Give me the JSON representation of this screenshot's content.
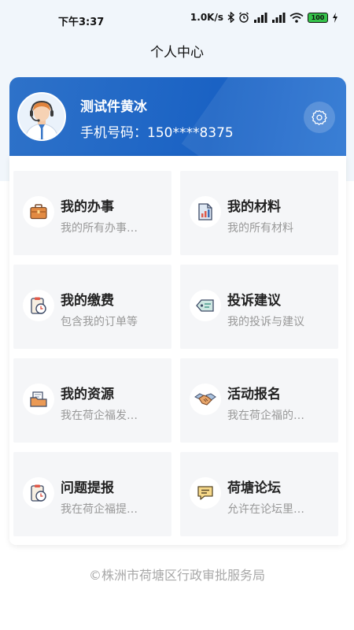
{
  "status_bar": {
    "time": "下午3:37",
    "network_speed": "1.0K/s",
    "battery": "100",
    "icons": [
      "bluetooth-icon",
      "alarm-icon",
      "signal-icon",
      "signal-icon",
      "wifi-icon",
      "battery-icon",
      "charging-icon"
    ]
  },
  "header": {
    "title": "个人中心"
  },
  "profile": {
    "name": "测试件黄冰",
    "phone": "手机号码：150****8375",
    "avatar_icon": "customer-service-avatar",
    "settings_icon": "gear-icon"
  },
  "menu": [
    {
      "title": "我的办事",
      "subtitle": "我的所有办事…",
      "icon": "briefcase-icon",
      "color": "#e07a3a"
    },
    {
      "title": "我的材料",
      "subtitle": "我的所有材料",
      "icon": "document-chart-icon",
      "color": "#e05a4a"
    },
    {
      "title": "我的缴费",
      "subtitle": "包含我的订单等",
      "icon": "clipboard-timer-icon",
      "color": "#e05a4a"
    },
    {
      "title": "投诉建议",
      "subtitle": "我的投诉与建议",
      "icon": "tag-icon",
      "color": "#4a9c8c"
    },
    {
      "title": "我的资源",
      "subtitle": "我在荷企福发…",
      "icon": "folder-box-icon",
      "color": "#e8884a"
    },
    {
      "title": "活动报名",
      "subtitle": "我在荷企福的…",
      "icon": "handshake-icon",
      "color": "#d88a4a"
    },
    {
      "title": "问题提报",
      "subtitle": "我在荷企福提…",
      "icon": "clipboard-timer-icon",
      "color": "#e05a4a"
    },
    {
      "title": "荷塘论坛",
      "subtitle": "允许在论坛里…",
      "icon": "chat-bubble-icon",
      "color": "#e8b84a"
    }
  ],
  "footer": {
    "text": "©株洲市荷塘区行政审批服务局"
  }
}
